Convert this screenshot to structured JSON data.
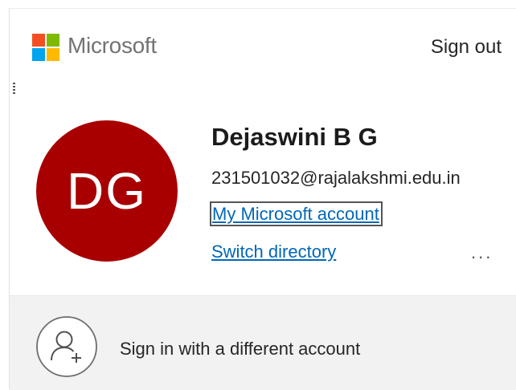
{
  "header": {
    "brand": "Microsoft",
    "sign_out_label": "Sign out",
    "logo_colors": [
      "#f25022",
      "#7fba00",
      "#00a4ef",
      "#ffb900"
    ]
  },
  "account": {
    "initials": "DG",
    "avatar_color": "#a80000",
    "name": "Dejaswini B G",
    "email": "231501032@rajalakshmi.edu.in",
    "my_account_label": "My Microsoft account",
    "switch_directory_label": "Switch directory",
    "more_options_label": "..."
  },
  "footer": {
    "different_account_label": "Sign in with a different account"
  },
  "colors": {
    "link": "#0067b8",
    "footer_bg": "#f2f2f2"
  }
}
